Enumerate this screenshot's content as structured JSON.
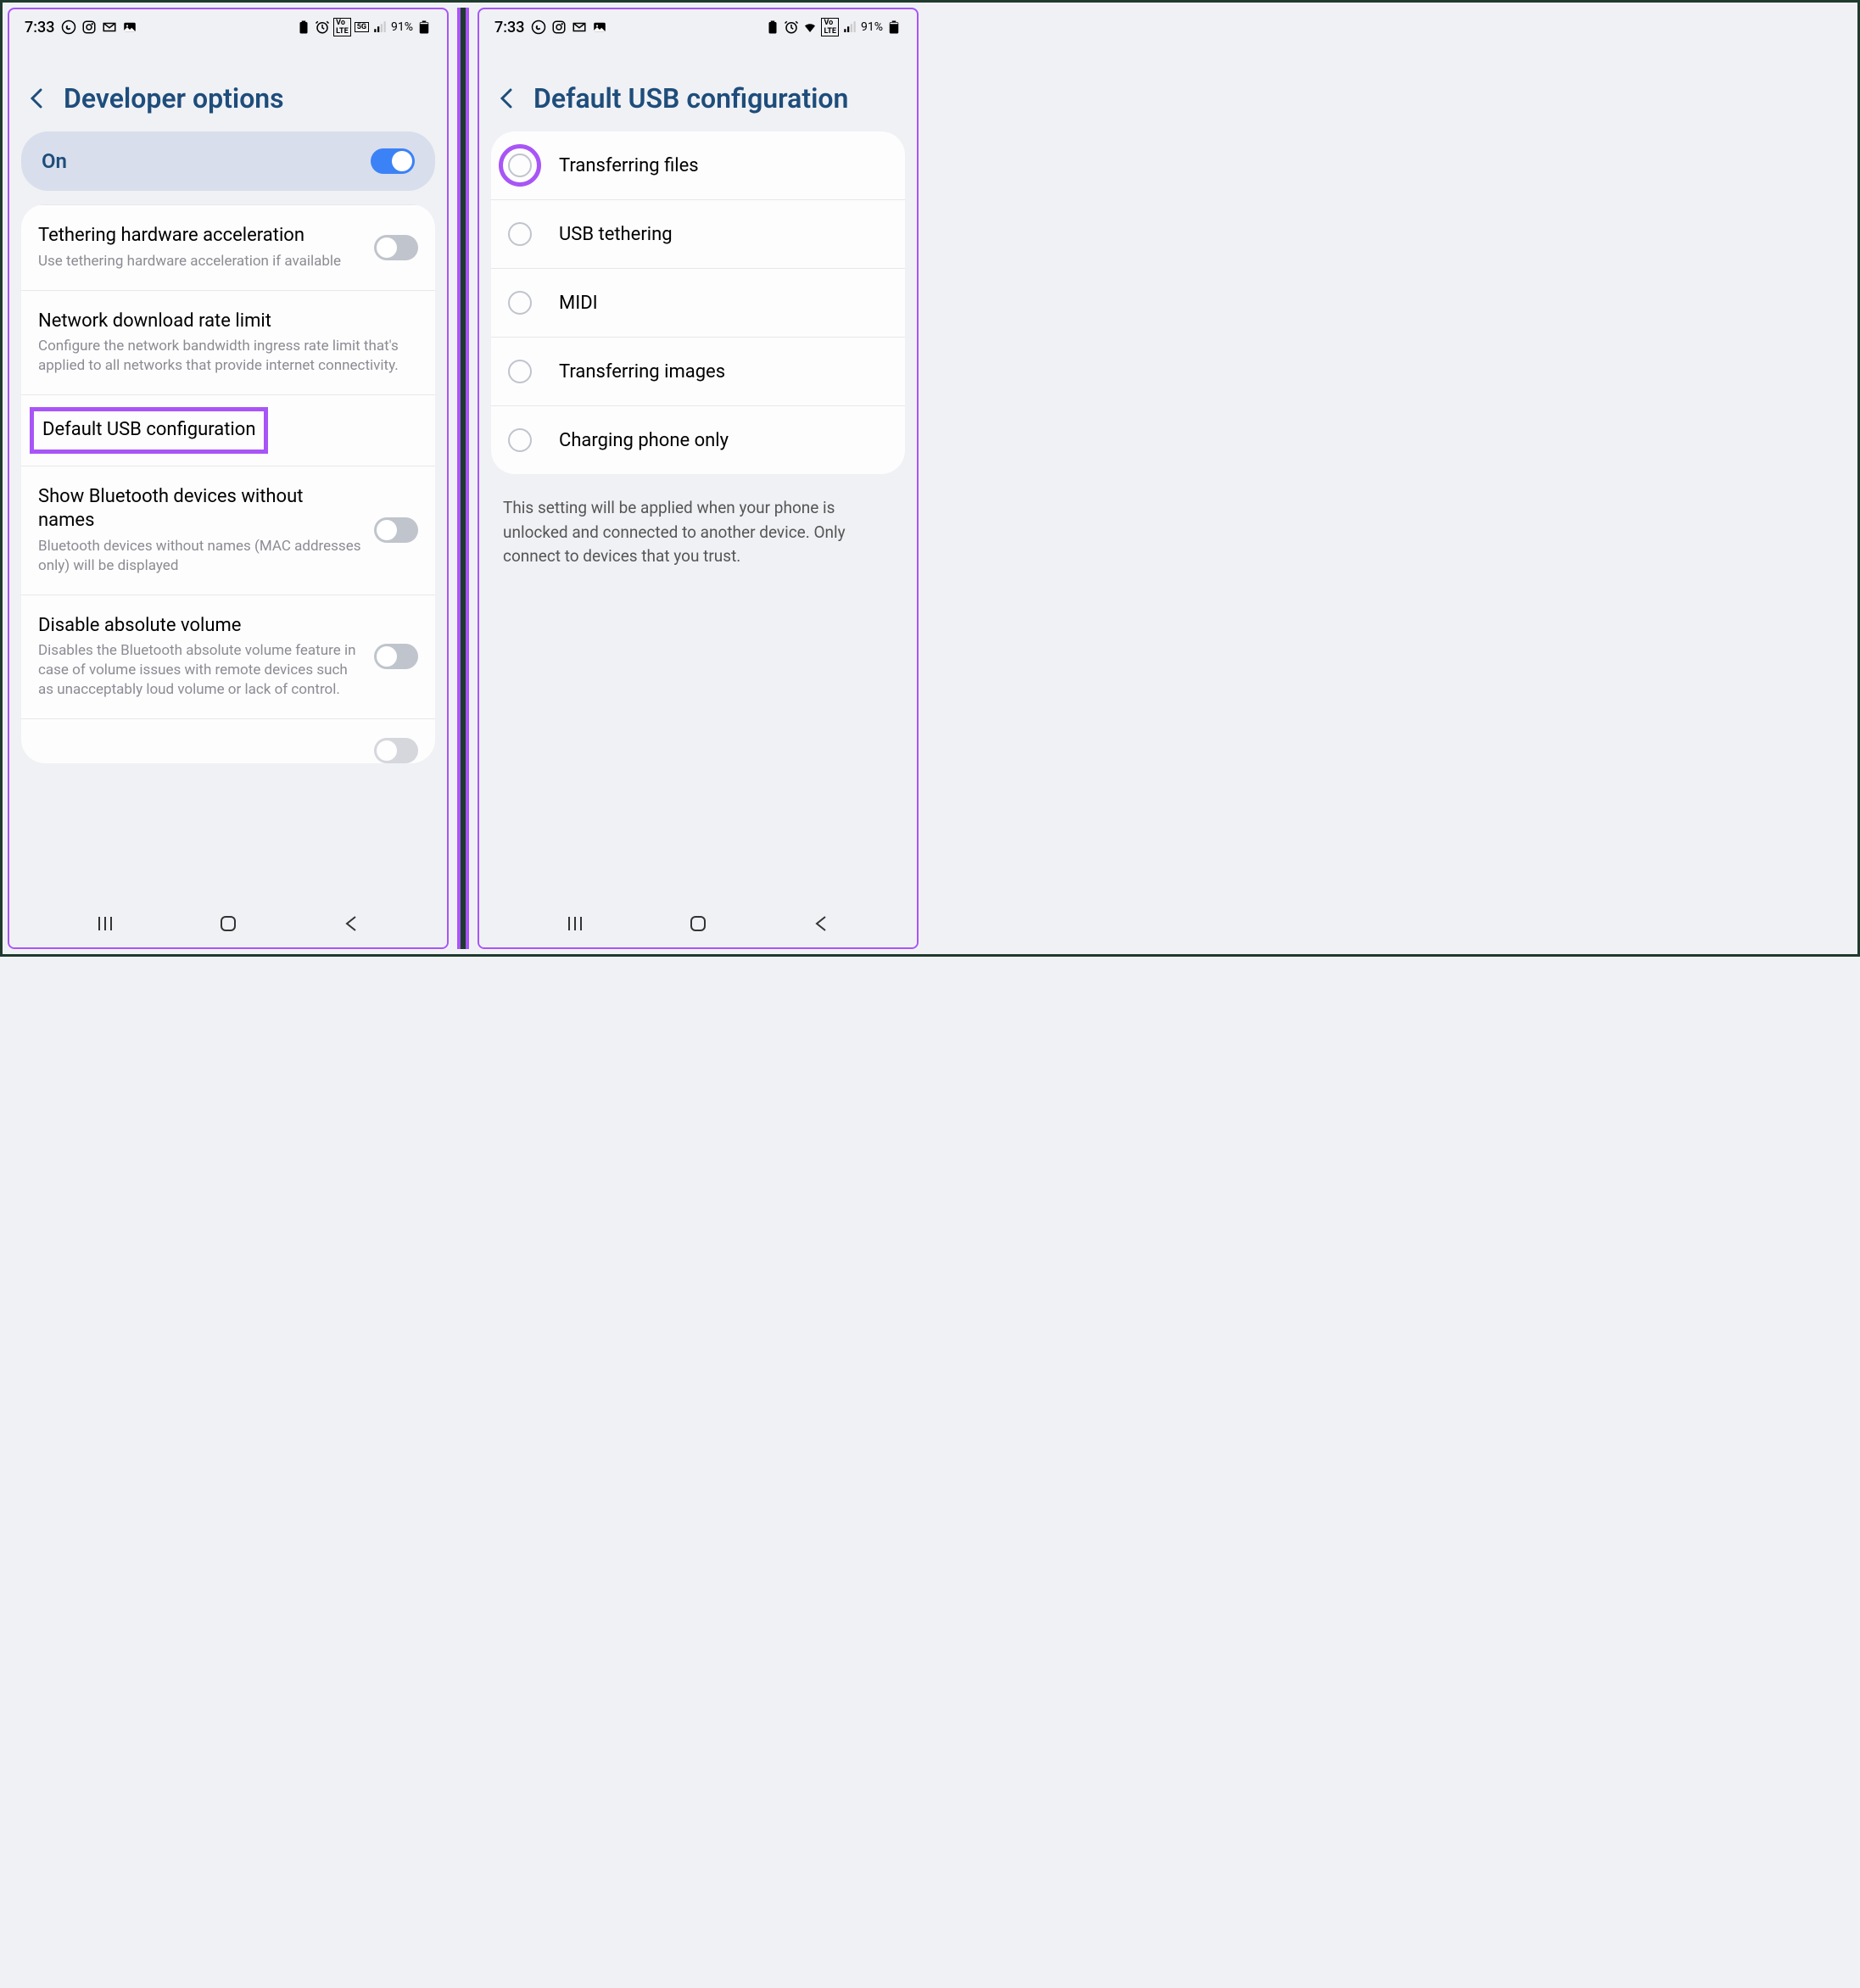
{
  "status": {
    "time": "7:33",
    "battery": "91%",
    "icons_left": [
      "whatsapp",
      "instagram",
      "gmail",
      "image"
    ],
    "icons_right_1": [
      "battery-saver",
      "alarm",
      "volte",
      "5g",
      "signal"
    ],
    "icons_right_2": [
      "battery-saver",
      "alarm",
      "wifi",
      "volte",
      "signal"
    ]
  },
  "screen1": {
    "title": "Developer options",
    "toggle": {
      "label": "On",
      "state": "on"
    },
    "items": [
      {
        "title": "Tethering hardware acceleration",
        "desc": "Use tethering hardware acceleration if available",
        "toggle": "off"
      },
      {
        "title": "Network download rate limit",
        "desc": "Configure the network bandwidth ingress rate limit that's applied to all networks that provide internet connectivity."
      },
      {
        "title": "Default USB configuration",
        "highlight": true
      },
      {
        "title": "Show Bluetooth devices without names",
        "desc": "Bluetooth devices without names (MAC addresses only) will be displayed",
        "toggle": "off"
      },
      {
        "title": "Disable absolute volume",
        "desc": "Disables the Bluetooth absolute volume feature in case of volume issues with remote devices such as unacceptably loud volume or lack of control.",
        "toggle": "off"
      }
    ]
  },
  "screen2": {
    "title": "Default USB configuration",
    "options": [
      {
        "label": "Transferring files",
        "highlight": true
      },
      {
        "label": "USB tethering"
      },
      {
        "label": "MIDI"
      },
      {
        "label": "Transferring images"
      },
      {
        "label": "Charging phone only"
      }
    ],
    "info": "This setting will be applied when your phone is unlocked and connected to another device. Only connect to devices that you trust."
  }
}
